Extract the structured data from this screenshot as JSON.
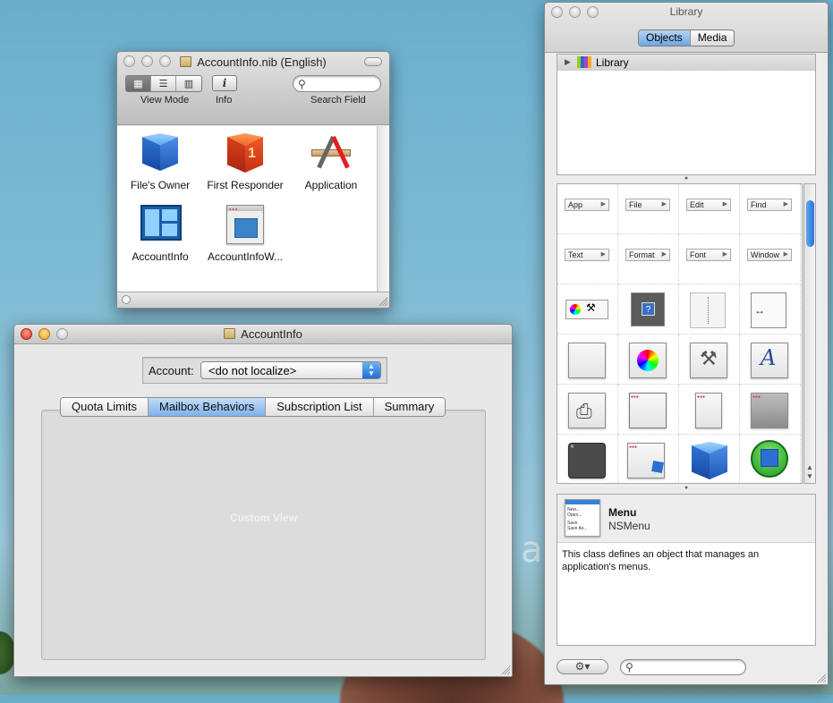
{
  "nib_window": {
    "title": "AccountInfo.nib (English)",
    "toolbar": {
      "view_mode_label": "View Mode",
      "info_label": "Info",
      "info_glyph": "i",
      "search_label": "Search Field",
      "search_placeholder": ""
    },
    "objects": [
      {
        "label": "File's Owner",
        "icon": "blue-cube-icon"
      },
      {
        "label": "First Responder",
        "icon": "red-cube-icon"
      },
      {
        "label": "Application",
        "icon": "application-icon"
      },
      {
        "label": "AccountInfo",
        "icon": "custom-view-icon"
      },
      {
        "label": "AccountInfoW...",
        "icon": "window-icon"
      }
    ]
  },
  "account_window": {
    "title": "AccountInfo",
    "account_label": "Account:",
    "account_value": "<do not localize>",
    "tabs": [
      {
        "label": "Quota Limits",
        "selected": false
      },
      {
        "label": "Mailbox Behaviors",
        "selected": true
      },
      {
        "label": "Subscription List",
        "selected": false
      },
      {
        "label": "Summary",
        "selected": false
      }
    ],
    "custom_view_label": "Custom View"
  },
  "library_window": {
    "title": "Library",
    "segments": [
      {
        "label": "Objects",
        "selected": true
      },
      {
        "label": "Media",
        "selected": false
      }
    ],
    "tree": {
      "root_label": "Library"
    },
    "menu_items": [
      "App",
      "File",
      "Edit",
      "Find",
      "Text",
      "Format",
      "Font",
      "Window"
    ],
    "selected_object": {
      "name": "Menu",
      "class": "NSMenu",
      "description": "This class defines an object that manages an application's menus.",
      "thumb_lines": [
        "New...",
        "Open...",
        "Save",
        "Save As..."
      ]
    },
    "search_placeholder": ""
  },
  "colors": {
    "selection_blue": "#7eb1ea",
    "close_red": "#e0311f",
    "minimize_yellow": "#e9a21a"
  }
}
